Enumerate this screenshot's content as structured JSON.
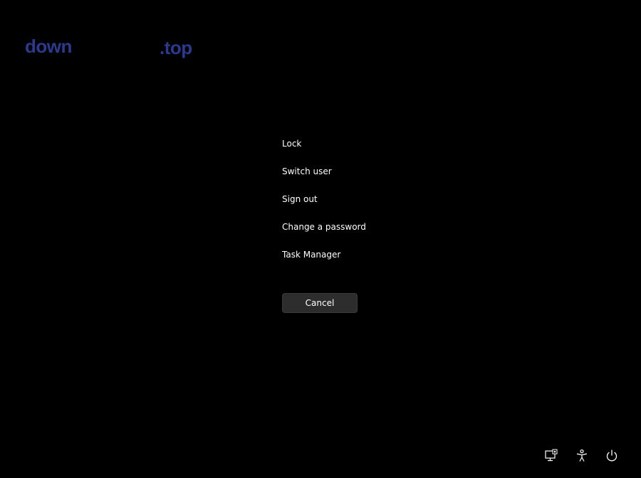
{
  "watermark": {
    "left_text": "down",
    "right_text": ".top"
  },
  "menu": {
    "items": [
      {
        "label": "Lock"
      },
      {
        "label": "Switch user"
      },
      {
        "label": "Sign out"
      },
      {
        "label": "Change a password"
      },
      {
        "label": "Task Manager"
      }
    ]
  },
  "cancel": {
    "label": "Cancel"
  },
  "tray": {
    "icons": [
      "network-icon",
      "accessibility-icon",
      "power-icon"
    ]
  },
  "colors": {
    "background": "#000000",
    "button": "#2d2d2d",
    "watermark": "#2b3a8f",
    "text": "#ffffff"
  }
}
